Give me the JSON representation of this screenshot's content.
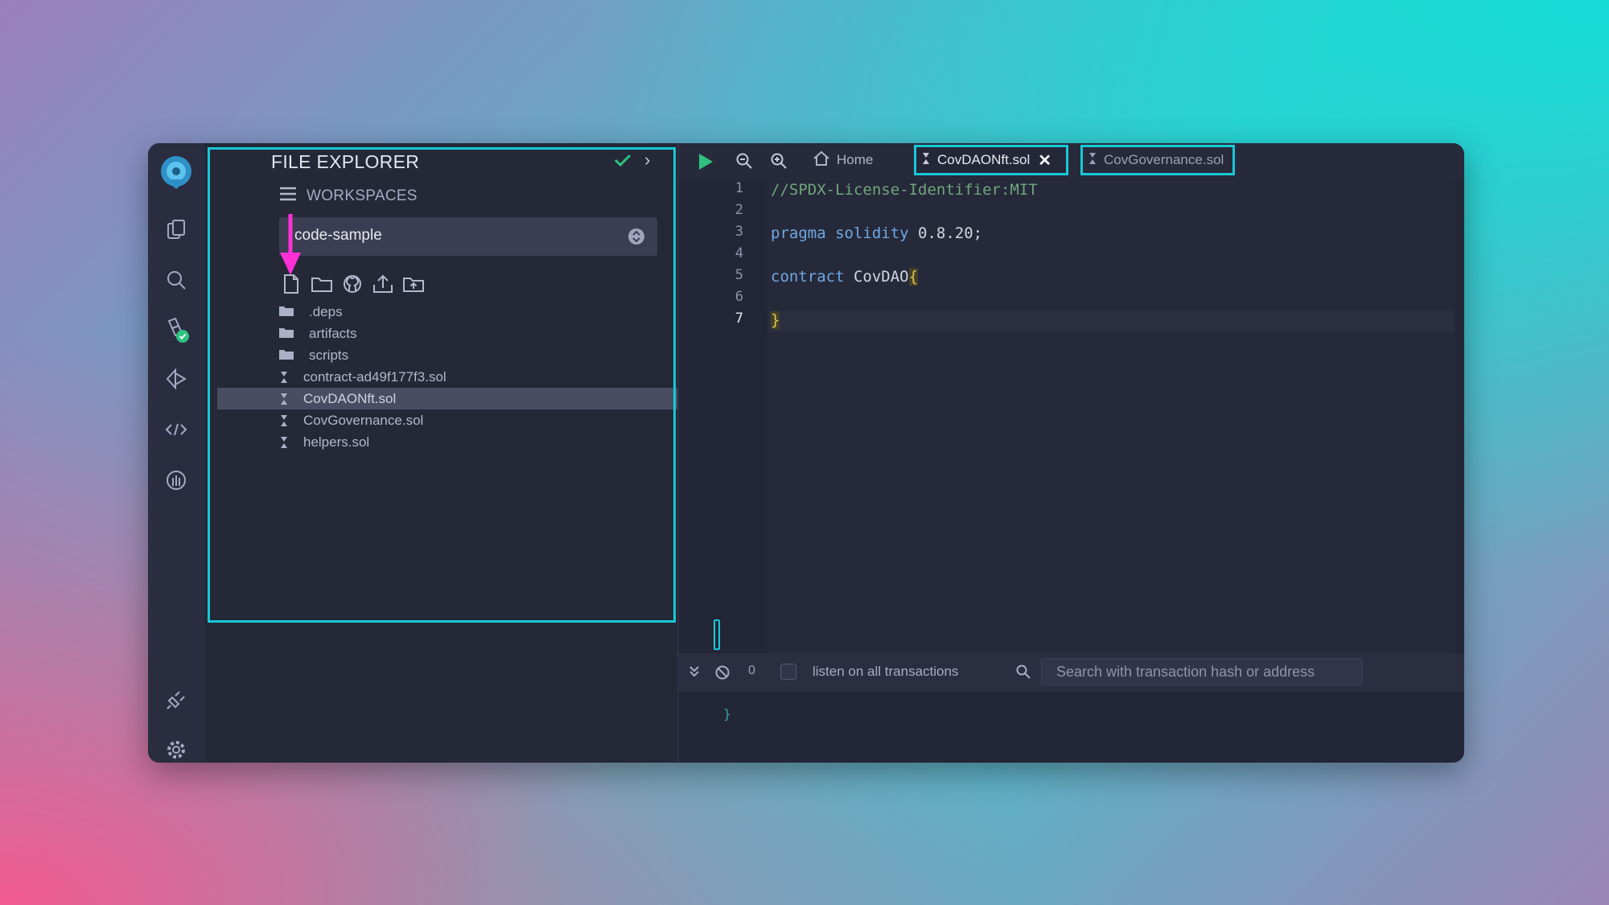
{
  "side_panel": {
    "title": "FILE EXPLORER",
    "workspaces_label": "WORKSPACES",
    "workspace_selected": "code-sample",
    "toolbar_icons": [
      "new-file-icon",
      "new-folder-icon",
      "github-icon",
      "upload-icon",
      "import-folder-icon"
    ],
    "tree": [
      {
        "name": ".deps",
        "type": "folder"
      },
      {
        "name": "artifacts",
        "type": "folder"
      },
      {
        "name": "scripts",
        "type": "folder"
      },
      {
        "name": "contract-ad49f177f3.sol",
        "type": "file"
      },
      {
        "name": "CovDAONft.sol",
        "type": "file",
        "selected": true
      },
      {
        "name": "CovGovernance.sol",
        "type": "file"
      },
      {
        "name": "helpers.sol",
        "type": "file"
      }
    ]
  },
  "rail_icons": [
    "remix-logo-icon",
    "file-explorer-icon",
    "search-icon",
    "solidity-compiler-icon",
    "deploy-run-icon",
    "debugger-icon",
    "analysis-icon",
    "plugin-manager-icon",
    "settings-icon"
  ],
  "tabs": {
    "home": "Home",
    "active": "CovDAONft.sol",
    "other": "CovGovernance.sol"
  },
  "editor": {
    "line_numbers": [
      "1",
      "2",
      "3",
      "4",
      "5",
      "6",
      "7"
    ],
    "active_line": "7",
    "lines": [
      {
        "parts": [
          {
            "t": "//SPDX-License-Identifier:MIT",
            "c": "comment"
          }
        ]
      },
      {
        "parts": []
      },
      {
        "parts": [
          {
            "t": "pragma solidity ",
            "c": "kw"
          },
          {
            "t": "0.8.20;",
            "c": "txt"
          }
        ]
      },
      {
        "parts": []
      },
      {
        "parts": [
          {
            "t": "contract ",
            "c": "kw"
          },
          {
            "t": "CovDAO",
            "c": "txt"
          },
          {
            "t": "{",
            "c": "brace"
          }
        ]
      },
      {
        "parts": []
      },
      {
        "parts": [
          {
            "t": "}",
            "c": "brace"
          }
        ]
      }
    ]
  },
  "terminal": {
    "count": "0",
    "listen_label": "listen on all transactions",
    "search_placeholder": "Search with transaction hash or address",
    "output_brace": "}"
  },
  "colors": {
    "highlight": "#18c8d6",
    "arrow": "#ff2fd6",
    "check": "#2ec27e",
    "run": "#2ec27e"
  }
}
